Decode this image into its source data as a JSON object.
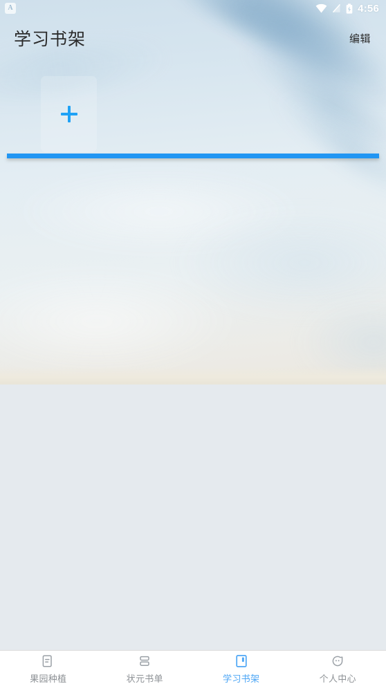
{
  "status_bar": {
    "notification_badge": "A",
    "notification_icon": "app-notification-icon",
    "wifi_icon": "wifi-icon",
    "signal_icon": "signal-off-icon",
    "battery_icon": "battery-charging-icon",
    "time": "4:56"
  },
  "header": {
    "title": "学习书架",
    "action_label": "编辑"
  },
  "shelf": {
    "add_tile_icon": "plus-icon",
    "add_tile_label": "",
    "books": []
  },
  "bottom_nav": {
    "items": [
      {
        "label": "果园种植",
        "icon": "document-icon",
        "active": false
      },
      {
        "label": "状元书单",
        "icon": "list-icon",
        "active": false
      },
      {
        "label": "学习书架",
        "icon": "book-icon",
        "active": true
      },
      {
        "label": "个人中心",
        "icon": "person-face-icon",
        "active": false
      }
    ]
  },
  "colors": {
    "accent_blue": "#2196F3",
    "plus_blue": "#1FA2F6",
    "active_tab": "#4DA6F5",
    "inactive_tab": "#8e9296",
    "lower_pane": "#e5eaee",
    "nav_background": "#ffffff"
  }
}
